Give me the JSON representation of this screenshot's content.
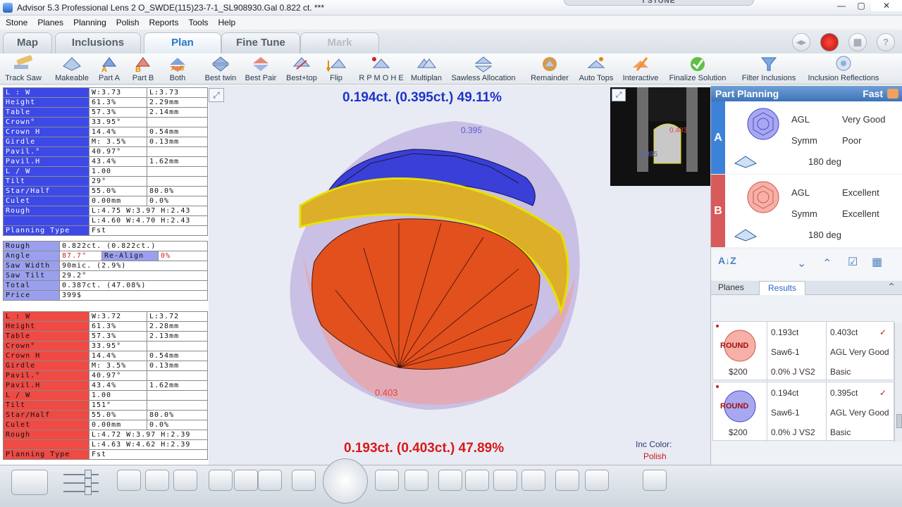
{
  "window": {
    "title": "Advisor 5.3 Professional Lens 2   O_SWDE(115)23-7-1_SL908930.Gal   0.822 ct. ***",
    "stone_tab": "I STONE",
    "min": "—",
    "max": "▢",
    "close": "✕"
  },
  "menu": [
    "Stone",
    "Planes",
    "Planning",
    "Polish",
    "Reports",
    "Tools",
    "Help"
  ],
  "tabs": [
    "Map",
    "Inclusions",
    "Plan",
    "Fine Tune",
    "Mark"
  ],
  "toolbar": [
    "Track Saw",
    "Makeable",
    "Part A",
    "Part B",
    "Both",
    "Best twin",
    "Best Pair",
    "Best+top",
    "Flip",
    "R P M O H E",
    "Multiplan",
    "Sawless Allocation",
    "Remainder",
    "Auto Tops",
    "Interactive",
    "Finalize Solution",
    "Filter Inclusions",
    "Inclusion Reflections"
  ],
  "tableA": [
    [
      "L : W",
      "W:3.73",
      "L:3.73"
    ],
    [
      "Height",
      "61.3%",
      "2.29mm"
    ],
    [
      "Table",
      "57.3%",
      "2.14mm"
    ],
    [
      "Crown°",
      "33.95°",
      ""
    ],
    [
      "Crown H",
      "14.4%",
      "0.54mm"
    ],
    [
      "Girdle",
      "M: 3.5%",
      "0.13mm"
    ],
    [
      "Pavil.°",
      "40.97°",
      ""
    ],
    [
      "Pavil.H",
      "43.4%",
      "1.62mm"
    ],
    [
      "L / W",
      "1.00",
      ""
    ],
    [
      "Tilt",
      "29°",
      ""
    ],
    [
      "Star/Half",
      "55.0%",
      "80.0%"
    ],
    [
      "Culet",
      "0.00mm",
      "0.0%"
    ],
    [
      "Rough",
      "L:4.75 W:3.97 H:2.43"
    ],
    [
      "",
      "L:4.60 W:4.70 H:2.43"
    ],
    [
      "Planning Type",
      "Fst"
    ]
  ],
  "mid": {
    "rough_l": "Rough",
    "rough_v": "0.822ct. (0.822ct.)",
    "angle_l": "Angle",
    "angle_v": "87.7°",
    "realign": "Re-Align",
    "realign_v": "0%",
    "saw_l": "Saw Width",
    "saw_v": "90mic. (2.9%)",
    "tilt_l": "Saw Tilt",
    "tilt_v": "29.2°",
    "total_l": "Total",
    "total_v": "0.387ct. (47.08%)",
    "price_l": "Price",
    "price_v": "399$"
  },
  "tableB": [
    [
      "L : W",
      "W:3.72",
      "L:3.72"
    ],
    [
      "Height",
      "61.3%",
      "2.28mm"
    ],
    [
      "Table",
      "57.3%",
      "2.13mm"
    ],
    [
      "Crown°",
      "33.95°",
      ""
    ],
    [
      "Crown H",
      "14.4%",
      "0.54mm"
    ],
    [
      "Girdle",
      "M: 3.5%",
      "0.13mm"
    ],
    [
      "Pavil.°",
      "40.97°",
      ""
    ],
    [
      "Pavil.H",
      "43.4%",
      "1.62mm"
    ],
    [
      "L / W",
      "1.00",
      ""
    ],
    [
      "Tilt",
      "151°",
      ""
    ],
    [
      "Star/Half",
      "55.0%",
      "80.0%"
    ],
    [
      "Culet",
      "0.00mm",
      "0.0%"
    ],
    [
      "Rough",
      "L:4.72 W:3.97 H:2.39"
    ],
    [
      "",
      "L:4.63 W:4.62 H:2.39"
    ],
    [
      "Planning Type",
      "Fst"
    ]
  ],
  "view": {
    "top_caption": "0.194ct. (0.395ct.) 49.11%",
    "bottom_caption": "0.193ct. (0.403ct.) 47.89%",
    "label_top": "0.395",
    "label_bottom": "0.403",
    "inc_color": "Inc Color:",
    "inc_val": "Polish",
    "thumb_a": "0.403",
    "thumb_b": "0.395"
  },
  "colors": {
    "blue_caption": "#1d34c8",
    "red_caption": "#d81818"
  },
  "planning": {
    "title": "Part Planning",
    "mode": "Fast",
    "A": {
      "letter": "A",
      "cut": "AGL",
      "grade": "Very Good",
      "symm": "Symm",
      "symm_v": "Poor",
      "deg": "180 deg"
    },
    "B": {
      "letter": "B",
      "cut": "AGL",
      "grade": "Excellent",
      "symm": "Symm",
      "symm_v": "Excellent",
      "deg": "180 deg"
    },
    "tabs": [
      "Planes",
      "Results"
    ],
    "results": [
      {
        "shape": "ROUND",
        "price": "$200",
        "ct1": "0.193ct",
        "ct2": "0.403ct",
        "saw": "Saw6-1",
        "grade": "AGL Very Good",
        "clar": "0.0%  J  VS2",
        "basic": "Basic"
      },
      {
        "shape": "ROUND",
        "price": "$200",
        "ct1": "0.194ct",
        "ct2": "0.395ct",
        "saw": "Saw6-1",
        "grade": "AGL Very Good",
        "clar": "0.0%  J  VS2",
        "basic": "Basic"
      }
    ]
  }
}
